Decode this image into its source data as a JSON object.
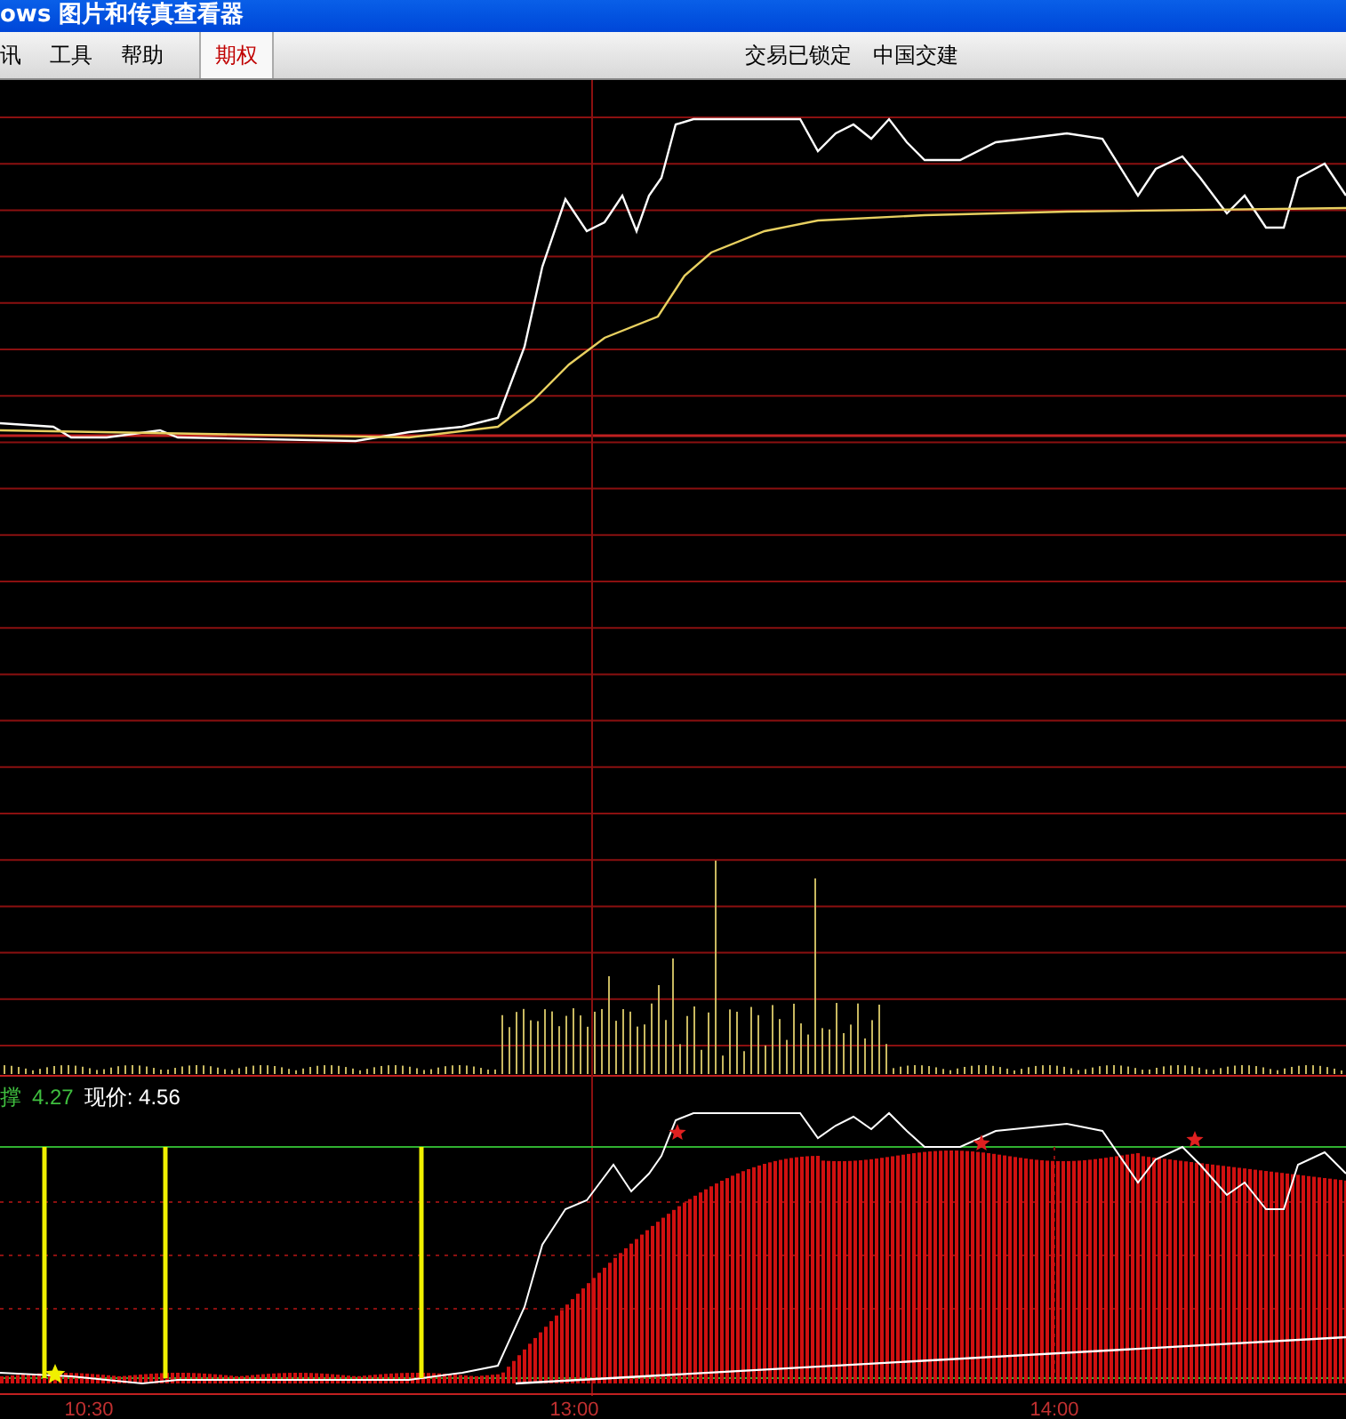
{
  "window": {
    "title": "ows  图片和传真查看器"
  },
  "menu": [
    {
      "label": "讯",
      "selected": false
    },
    {
      "label": "工具",
      "selected": false
    },
    {
      "label": "帮助",
      "selected": false
    },
    {
      "label": "期权",
      "selected": true
    }
  ],
  "status": [
    "交易已锁定",
    "中国交建"
  ],
  "indicator": {
    "label": "撑",
    "value": "4.27",
    "price": "现价: 4.56"
  },
  "time_axis": [
    "10:30",
    "13:00",
    "14:00"
  ]
}
